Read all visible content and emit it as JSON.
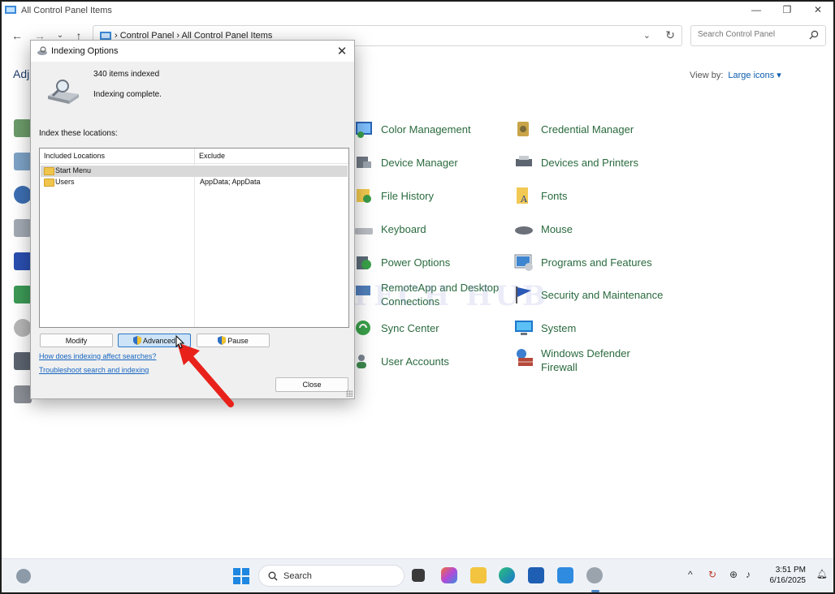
{
  "window": {
    "title": "All Control Panel Items",
    "minimize": "—",
    "maximize": "❐",
    "close": "✕"
  },
  "address": {
    "crumbs": "›  Control Panel  ›  All Control Panel Items",
    "search_placeholder": "Search Control Panel"
  },
  "page": {
    "heading": "Adj",
    "view_by_label": "View by:",
    "view_by_value": "Large icons ▾"
  },
  "items_col1": [
    {
      "label": "Color Management",
      "icon": "color-management-icon"
    },
    {
      "label": "Device Manager",
      "icon": "device-manager-icon"
    },
    {
      "label": "File History",
      "icon": "file-history-icon"
    },
    {
      "label": "Keyboard",
      "icon": "keyboard-icon"
    },
    {
      "label": "Power Options",
      "icon": "power-options-icon"
    },
    {
      "label": "RemoteApp and Desktop Connections",
      "icon": "remoteapp-icon"
    },
    {
      "label": "Sync Center",
      "icon": "sync-center-icon"
    },
    {
      "label": "User Accounts",
      "icon": "user-accounts-icon"
    }
  ],
  "items_col2": [
    {
      "label": "Credential Manager",
      "icon": "credential-manager-icon"
    },
    {
      "label": "Devices and Printers",
      "icon": "devices-printers-icon"
    },
    {
      "label": "Fonts",
      "icon": "fonts-icon"
    },
    {
      "label": "Mouse",
      "icon": "mouse-icon"
    },
    {
      "label": "Programs and Features",
      "icon": "programs-features-icon"
    },
    {
      "label": "Security and Maintenance",
      "icon": "security-flag-icon"
    },
    {
      "label": "System",
      "icon": "system-monitor-icon"
    },
    {
      "label": "Windows Defender Firewall",
      "icon": "firewall-icon"
    }
  ],
  "watermark": "IT TECH HUB",
  "dialog": {
    "title": "Indexing Options",
    "close": "✕",
    "items_indexed": "340 items indexed",
    "status": "Indexing complete.",
    "index_label": "Index these locations:",
    "col_included": "Included Locations",
    "col_exclude": "Exclude",
    "locations": [
      {
        "name": "Start Menu",
        "exclude": ""
      },
      {
        "name": "Users",
        "exclude": "AppData; AppData"
      }
    ],
    "modify_label": "Modify",
    "advanced_label": "Advanced",
    "pause_label": "Pause",
    "link1": "How does indexing affect searches?",
    "link2": "Troubleshoot search and indexing",
    "close_label": "Close"
  },
  "taskbar": {
    "search_label": "Search",
    "tray_chevron": "^",
    "time": "3:51 PM",
    "date": "6/16/2025"
  },
  "colors": {
    "link": "#1565c0",
    "cp_label": "#2a6a3e",
    "arrow": "#e8221b",
    "focus_button": "#cde3f7"
  }
}
